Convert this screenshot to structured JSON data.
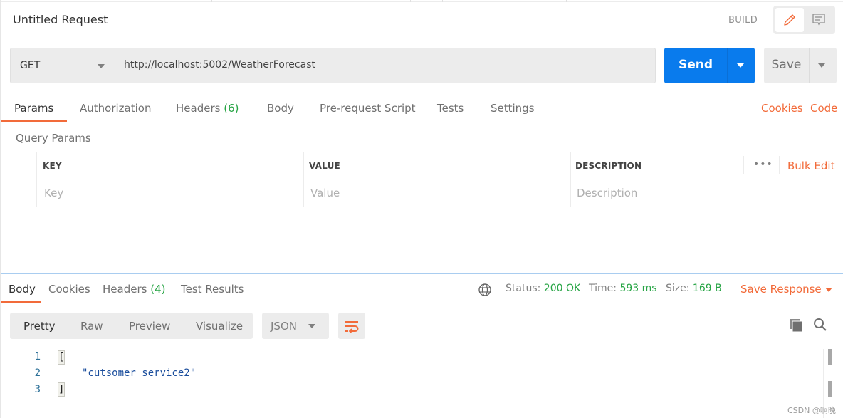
{
  "header": {
    "title": "Untitled Request",
    "mode_label": "BUILD",
    "mode_buttons": [
      {
        "icon": "pencil-icon",
        "active": true
      },
      {
        "icon": "comment-icon",
        "active": false
      }
    ]
  },
  "request": {
    "method": "GET",
    "url": "http://localhost:5002/WeatherForecast",
    "send_label": "Send",
    "save_label": "Save"
  },
  "request_tabs": [
    {
      "label": "Params",
      "active": true
    },
    {
      "label": "Authorization"
    },
    {
      "label": "Headers",
      "count": "(6)"
    },
    {
      "label": "Body"
    },
    {
      "label": "Pre-request Script"
    },
    {
      "label": "Tests"
    },
    {
      "label": "Settings"
    }
  ],
  "request_links": {
    "cookies": "Cookies",
    "code": "Code"
  },
  "params": {
    "section_title": "Query Params",
    "columns": [
      "KEY",
      "VALUE",
      "DESCRIPTION"
    ],
    "placeholders": {
      "key": "Key",
      "value": "Value",
      "description": "Description"
    },
    "more_label": "•••",
    "bulk_edit": "Bulk Edit"
  },
  "response_tabs": [
    {
      "label": "Body",
      "active": true
    },
    {
      "label": "Cookies"
    },
    {
      "label": "Headers",
      "count": "(4)"
    },
    {
      "label": "Test Results"
    }
  ],
  "response_status": {
    "status_label": "Status:",
    "status_value": "200 OK",
    "time_label": "Time:",
    "time_value": "593 ms",
    "size_label": "Size:",
    "size_value": "169 B",
    "save_response": "Save Response",
    "colors": {
      "success": "#26a444",
      "accent": "#f26b3a",
      "primary": "#097bed"
    }
  },
  "response_view": {
    "modes": [
      "Pretty",
      "Raw",
      "Preview",
      "Visualize"
    ],
    "active_mode": "Pretty",
    "format": "JSON"
  },
  "response_body": {
    "lines": [
      {
        "n": "1",
        "text": "["
      },
      {
        "n": "2",
        "text": "\"cutsomer service2\""
      },
      {
        "n": "3",
        "text": "]"
      }
    ]
  },
  "watermark": "CSDN @啊晚"
}
